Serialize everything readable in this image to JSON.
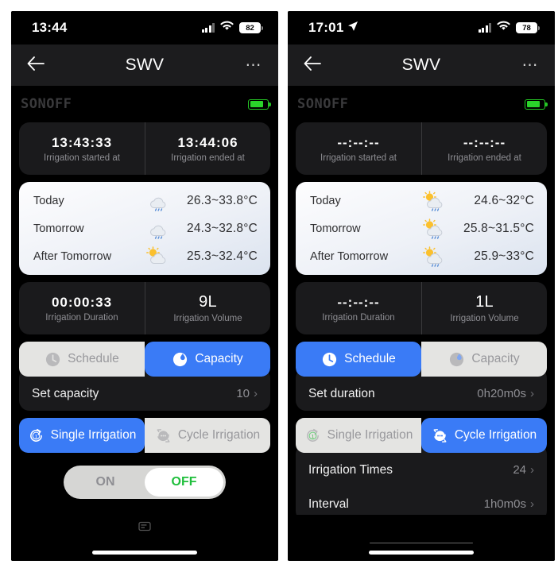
{
  "phones": [
    {
      "id": "left",
      "status": {
        "time": "13:44",
        "has_location_icon": false,
        "battery": "82",
        "signal_icon": "cellular-signal-icon",
        "wifi_icon": "wifi-icon",
        "battery_icon": "battery-icon"
      },
      "nav": {
        "back_icon": "back-arrow-icon",
        "title": "SWV",
        "more_icon": "more-options-icon"
      },
      "brand": {
        "logo": "SONOFF",
        "device_battery_icon": "device-battery-icon"
      },
      "time_card": {
        "start_value": "13:43:33",
        "start_label": "Irrigation started at",
        "end_value": "13:44:06",
        "end_label": "Irrigation ended at",
        "is_placeholder": false
      },
      "weather": [
        {
          "day": "Today",
          "icon": "rain-cloud-icon",
          "temp": "26.3~33.8°C"
        },
        {
          "day": "Tomorrow",
          "icon": "rain-cloud-icon",
          "temp": "24.3~32.8°C"
        },
        {
          "day": "After Tomorrow",
          "icon": "sun-cloud-icon",
          "temp": "25.3~32.4°C"
        }
      ],
      "summary_card": {
        "duration_value": "00:00:33",
        "duration_label": "Irrigation Duration",
        "volume_value": "9L",
        "volume_label": "Irrigation Volume",
        "duration_is_placeholder": false
      },
      "mode_segment": {
        "left": {
          "label": "Schedule",
          "icon": "schedule-clock-icon",
          "active": false
        },
        "right": {
          "label": "Capacity",
          "icon": "capacity-drop-icon",
          "active": true
        }
      },
      "setting_rows": [
        {
          "label": "Set capacity",
          "value": "10",
          "name": "set-capacity-row"
        }
      ],
      "irrigation_segment": {
        "left": {
          "label": "Single Irrigation",
          "icon": "single-irrigation-icon",
          "active": true
        },
        "right": {
          "label": "Cycle Irrigation",
          "icon": "cycle-irrigation-icon",
          "active": false
        }
      },
      "extra_rows": [],
      "onoff": {
        "on_label": "ON",
        "off_label": "OFF",
        "selected": "OFF"
      },
      "show_onoff": true,
      "show_keyboard_icon": true,
      "show_thin_line": false
    },
    {
      "id": "right",
      "status": {
        "time": "17:01",
        "has_location_icon": true,
        "battery": "78",
        "signal_icon": "cellular-signal-icon",
        "wifi_icon": "wifi-icon",
        "battery_icon": "battery-icon"
      },
      "nav": {
        "back_icon": "back-arrow-icon",
        "title": "SWV",
        "more_icon": "more-options-icon"
      },
      "brand": {
        "logo": "SONOFF",
        "device_battery_icon": "device-battery-icon"
      },
      "time_card": {
        "start_value": "--:--:--",
        "start_label": "Irrigation started at",
        "end_value": "--:--:--",
        "end_label": "Irrigation ended at",
        "is_placeholder": true
      },
      "weather": [
        {
          "day": "Today",
          "icon": "sun-rain-cloud-icon",
          "temp": "24.6~32°C"
        },
        {
          "day": "Tomorrow",
          "icon": "sun-rain-cloud-icon",
          "temp": "25.8~31.5°C"
        },
        {
          "day": "After Tomorrow",
          "icon": "sun-rain-cloud-icon",
          "temp": "25.9~33°C"
        }
      ],
      "summary_card": {
        "duration_value": "--:--:--",
        "duration_label": "Irrigation Duration",
        "volume_value": "1L",
        "volume_label": "Irrigation Volume",
        "duration_is_placeholder": true
      },
      "mode_segment": {
        "left": {
          "label": "Schedule",
          "icon": "schedule-clock-icon",
          "active": true
        },
        "right": {
          "label": "Capacity",
          "icon": "capacity-drop-icon",
          "active": false
        }
      },
      "setting_rows": [
        {
          "label": "Set duration",
          "value": "0h20m0s",
          "name": "set-duration-row"
        }
      ],
      "irrigation_segment": {
        "left": {
          "label": "Single Irrigation",
          "icon": "single-irrigation-icon",
          "active": false
        },
        "right": {
          "label": "Cycle Irrigation",
          "icon": "cycle-irrigation-icon",
          "active": true
        }
      },
      "extra_rows": [
        {
          "label": "Irrigation Times",
          "value": "24",
          "name": "irrigation-times-row"
        },
        {
          "label": "Interval",
          "value": "1h0m0s",
          "name": "interval-row"
        }
      ],
      "onoff": null,
      "show_onoff": false,
      "show_keyboard_icon": false,
      "show_thin_line": true
    }
  ],
  "colors": {
    "accent_blue": "#3a7bf6",
    "inactive_segment": "#e4e4e2",
    "card_dark": "#1a1a1c",
    "nav_dark": "#1c1c1e",
    "green_on": "#1fbf3c",
    "device_battery_green": "#2ad42a"
  },
  "chevron_glyph": "›"
}
